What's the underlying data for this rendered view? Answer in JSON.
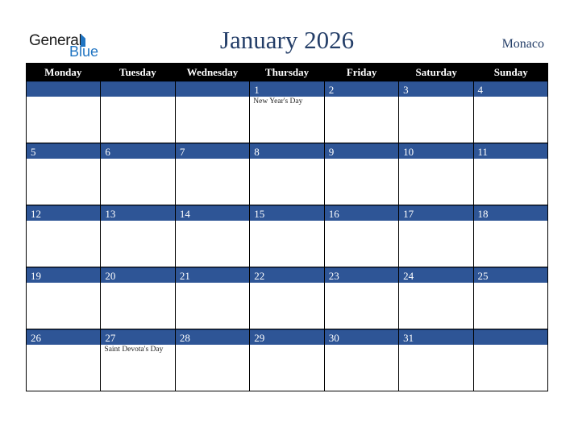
{
  "logo": {
    "word1": "General",
    "word2": "Blue"
  },
  "header": {
    "title": "January 2026",
    "country": "Monaco"
  },
  "colors": {
    "title": "#243e68",
    "day_bar": "#2e5596",
    "header_bg": "#000000",
    "logo_blue": "#1f74c2"
  },
  "weekdays": [
    "Monday",
    "Tuesday",
    "Wednesday",
    "Thursday",
    "Friday",
    "Saturday",
    "Sunday"
  ],
  "weeks": [
    [
      {
        "day": "",
        "event": ""
      },
      {
        "day": "",
        "event": ""
      },
      {
        "day": "",
        "event": ""
      },
      {
        "day": "1",
        "event": "New Year's Day"
      },
      {
        "day": "2",
        "event": ""
      },
      {
        "day": "3",
        "event": ""
      },
      {
        "day": "4",
        "event": ""
      }
    ],
    [
      {
        "day": "5",
        "event": ""
      },
      {
        "day": "6",
        "event": ""
      },
      {
        "day": "7",
        "event": ""
      },
      {
        "day": "8",
        "event": ""
      },
      {
        "day": "9",
        "event": ""
      },
      {
        "day": "10",
        "event": ""
      },
      {
        "day": "11",
        "event": ""
      }
    ],
    [
      {
        "day": "12",
        "event": ""
      },
      {
        "day": "13",
        "event": ""
      },
      {
        "day": "14",
        "event": ""
      },
      {
        "day": "15",
        "event": ""
      },
      {
        "day": "16",
        "event": ""
      },
      {
        "day": "17",
        "event": ""
      },
      {
        "day": "18",
        "event": ""
      }
    ],
    [
      {
        "day": "19",
        "event": ""
      },
      {
        "day": "20",
        "event": ""
      },
      {
        "day": "21",
        "event": ""
      },
      {
        "day": "22",
        "event": ""
      },
      {
        "day": "23",
        "event": ""
      },
      {
        "day": "24",
        "event": ""
      },
      {
        "day": "25",
        "event": ""
      }
    ],
    [
      {
        "day": "26",
        "event": ""
      },
      {
        "day": "27",
        "event": "Saint Devota's Day"
      },
      {
        "day": "28",
        "event": ""
      },
      {
        "day": "29",
        "event": ""
      },
      {
        "day": "30",
        "event": ""
      },
      {
        "day": "31",
        "event": ""
      },
      {
        "day": "",
        "event": ""
      }
    ]
  ]
}
